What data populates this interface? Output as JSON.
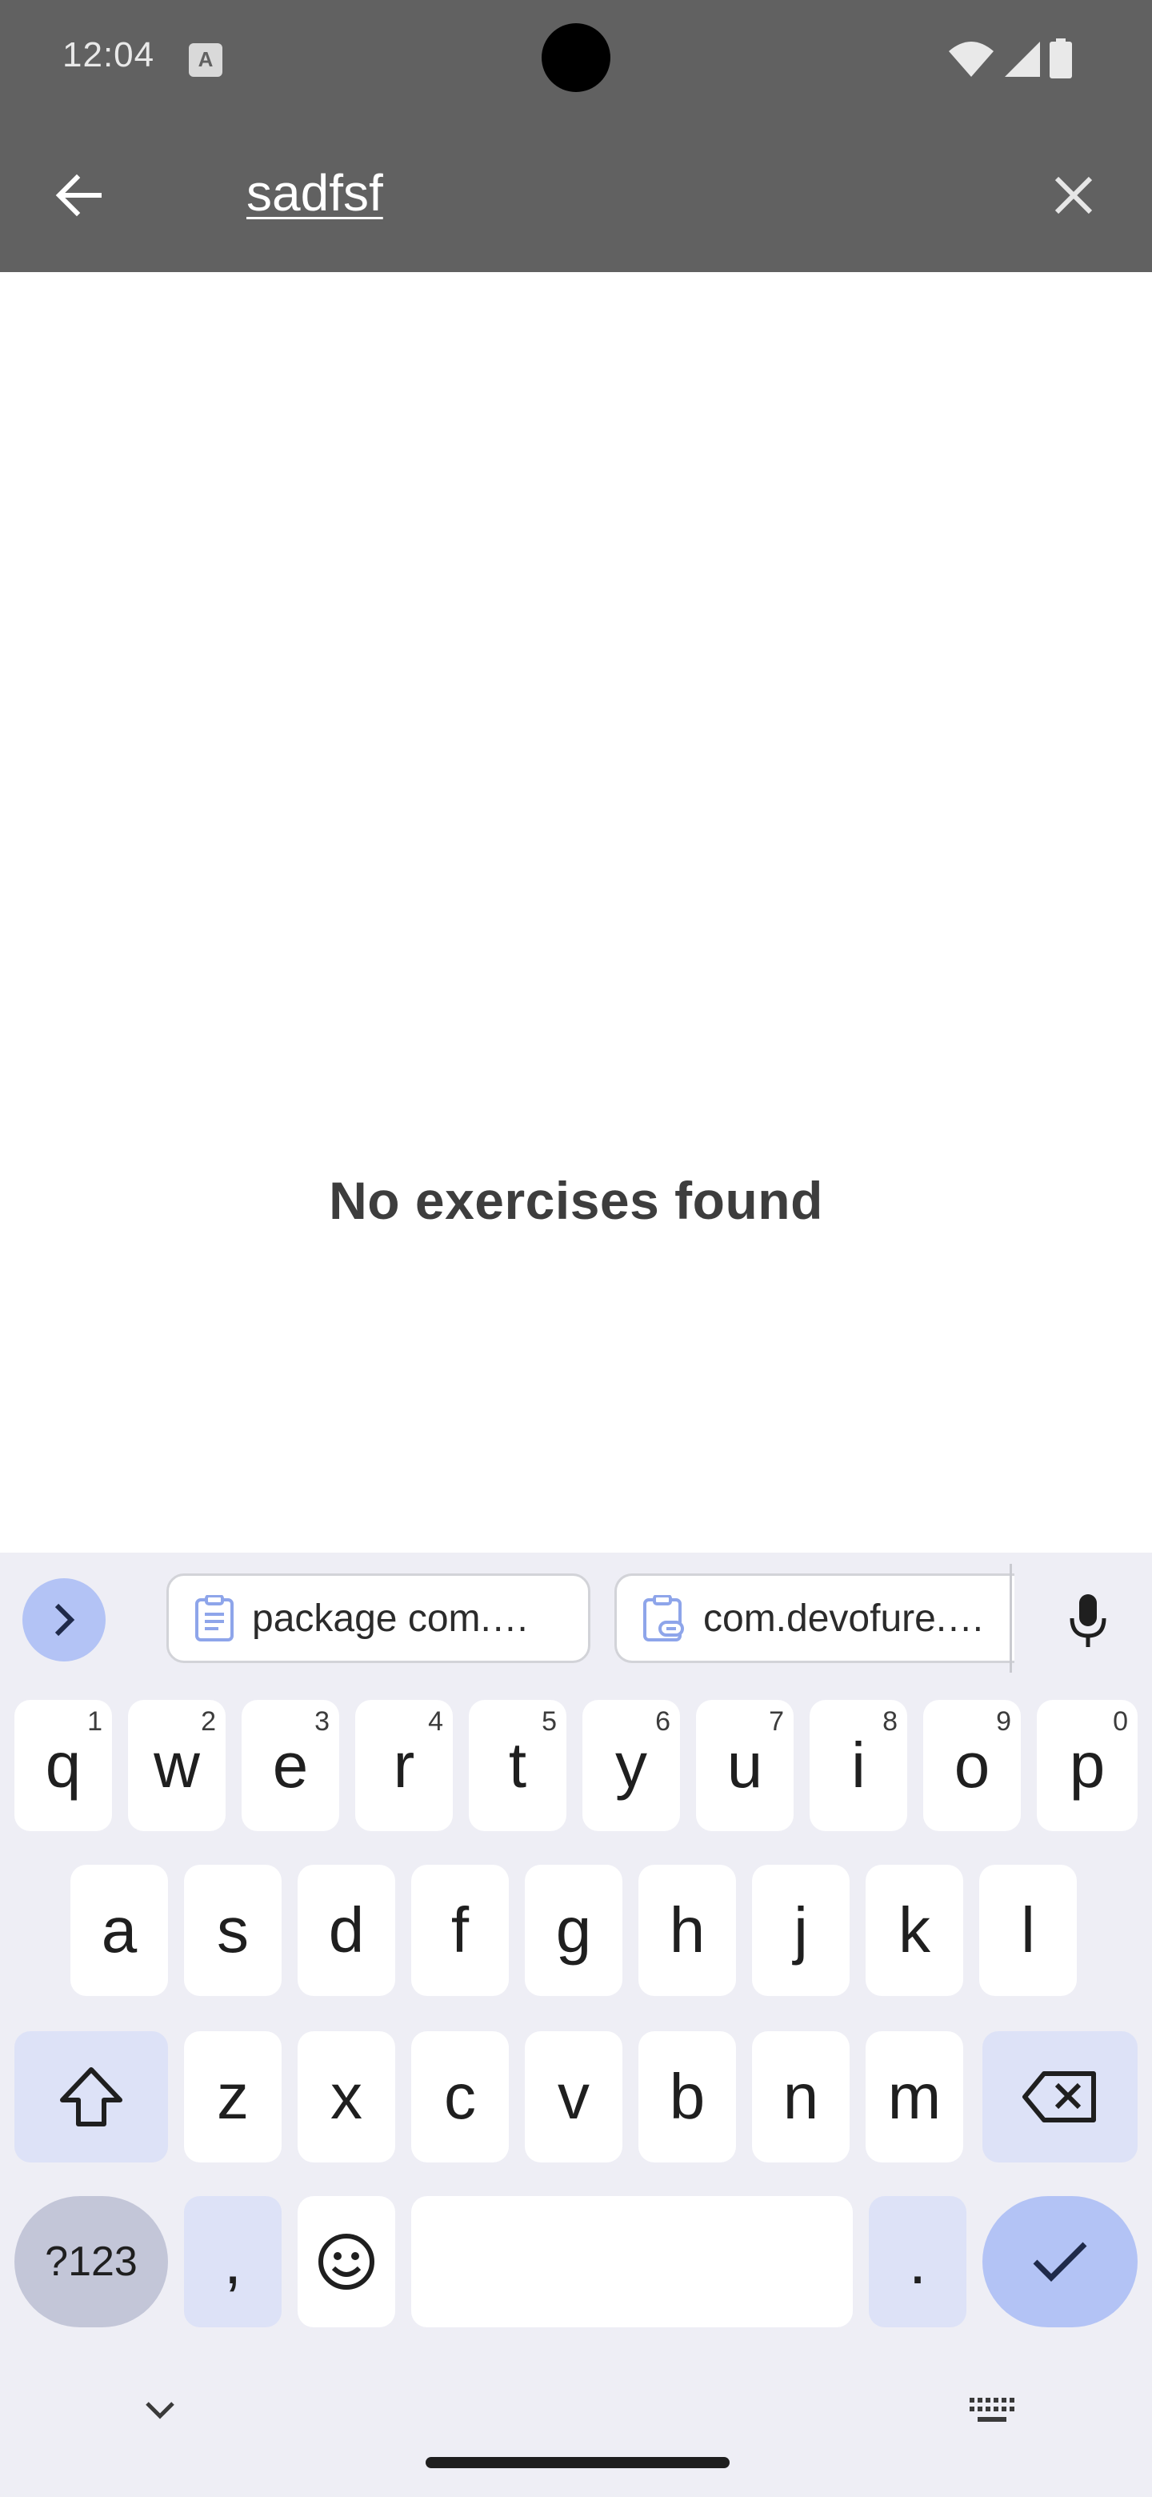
{
  "status_bar": {
    "time": "12:04",
    "app_icon_letter": "A"
  },
  "search": {
    "query": "sadfsf"
  },
  "results": {
    "empty_message": "No exercises found"
  },
  "keyboard": {
    "clipboard_chips": [
      {
        "label": "package com.…",
        "icon": "clipboard-icon"
      },
      {
        "label": "com.devofure.…",
        "icon": "clipboard-link-icon"
      }
    ],
    "rows": {
      "row1": [
        {
          "label": "q",
          "hint": "1"
        },
        {
          "label": "w",
          "hint": "2"
        },
        {
          "label": "e",
          "hint": "3"
        },
        {
          "label": "r",
          "hint": "4"
        },
        {
          "label": "t",
          "hint": "5"
        },
        {
          "label": "y",
          "hint": "6"
        },
        {
          "label": "u",
          "hint": "7"
        },
        {
          "label": "i",
          "hint": "8"
        },
        {
          "label": "o",
          "hint": "9"
        },
        {
          "label": "p",
          "hint": "0"
        }
      ],
      "row2": [
        {
          "label": "a"
        },
        {
          "label": "s"
        },
        {
          "label": "d"
        },
        {
          "label": "f"
        },
        {
          "label": "g"
        },
        {
          "label": "h"
        },
        {
          "label": "j"
        },
        {
          "label": "k"
        },
        {
          "label": "l"
        }
      ],
      "row3": [
        {
          "label": "z"
        },
        {
          "label": "x"
        },
        {
          "label": "c"
        },
        {
          "label": "v"
        },
        {
          "label": "b"
        },
        {
          "label": "n"
        },
        {
          "label": "m"
        }
      ]
    },
    "symbols_label": "?123",
    "comma_label": ",",
    "period_label": ".",
    "accent_color": "#b3c3f5"
  }
}
